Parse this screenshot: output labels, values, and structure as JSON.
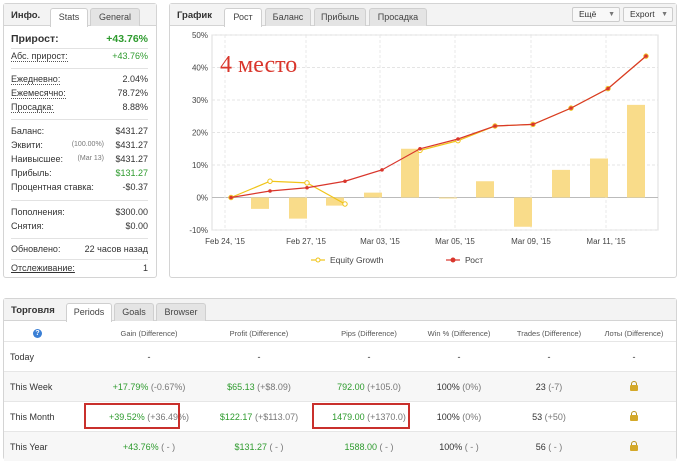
{
  "info": {
    "title": "Инфо.",
    "tabs": [
      "Stats",
      "General"
    ],
    "rows": [
      {
        "label": "Прирост:",
        "value": "+43.76%"
      },
      {
        "label": "Абс. прирост:",
        "value": "+43.76%"
      },
      {
        "label": "Ежедневно:",
        "value": "2.04%"
      },
      {
        "label": "Ежемесячно:",
        "value": "78.72%"
      },
      {
        "label": "Просадка:",
        "value": "8.88%"
      },
      {
        "label": "Баланс:",
        "value": "$431.27"
      },
      {
        "label": "Эквити:",
        "sub": "(100.00%)",
        "value": "$431.27"
      },
      {
        "label": "Наивысшее:",
        "sub": "(Mar 13)",
        "value": "$431.27"
      },
      {
        "label": "Прибыль:",
        "value": "$131.27"
      },
      {
        "label": "Процентная ставка:",
        "value": "-$0.37"
      },
      {
        "label": "Пополнения:",
        "value": "$300.00"
      },
      {
        "label": "Снятия:",
        "value": "$0.00"
      },
      {
        "label": "Обновлено:",
        "value": "22 часов назад"
      },
      {
        "label": "Отслеживание:",
        "value": "1"
      }
    ]
  },
  "chart_panel": {
    "title": "График",
    "tabs": [
      "Рост",
      "Баланс",
      "Прибыль",
      "Просадка"
    ],
    "more_button": "Ещё",
    "export_button": "Export",
    "annotation": "4 место"
  },
  "chart_data": {
    "type": "bar+line",
    "x_ticks": [
      "Feb 24, '15",
      "Feb 27, '15",
      "Mar 03, '15",
      "Mar 05, '15",
      "Mar 09, '15",
      "Mar 11, '15"
    ],
    "y_ticks": [
      "50%",
      "40%",
      "30%",
      "20%",
      "10%",
      "0%",
      "-10%"
    ],
    "ylim": [
      -10,
      50
    ],
    "bars": [
      -3.5,
      -6.5,
      -2.5,
      1.5,
      15,
      0,
      5,
      -9,
      8.5,
      12,
      28.5
    ],
    "series": [
      {
        "name": "Equity Growth",
        "color": "#f0c419",
        "values": [
          0,
          5,
          4.5,
          -2,
          null,
          14.5,
          17.5,
          22,
          22.5,
          27.5,
          33.5,
          43.5
        ]
      },
      {
        "name": "Рост",
        "color": "#d9362c",
        "values": [
          0,
          2,
          3,
          5,
          8.5,
          15,
          18,
          22,
          22.5,
          27.5,
          33.5,
          43.5
        ]
      }
    ],
    "grid": true,
    "legend": "bottom"
  },
  "trade": {
    "title": "Торговля",
    "tabs": [
      "Periods",
      "Goals",
      "Browser"
    ],
    "help_icon": "?",
    "headers": [
      "Gain (Difference)",
      "Profit (Difference)",
      "Pips (Difference)",
      "Win % (Difference)",
      "Trades (Difference)",
      "Лоты (Difference)"
    ],
    "rows": [
      {
        "name": "Today",
        "gain": "-",
        "gain_diff": "",
        "profit": "-",
        "profit_diff": "",
        "pips": "-",
        "pips_diff": "",
        "win": "-",
        "win_diff": "",
        "trades": "-",
        "trades_diff": "",
        "lots": "-"
      },
      {
        "name": "This Week",
        "gain": "+17.79%",
        "gain_diff": "(-0.67%)",
        "profit": "$65.13",
        "profit_diff": "(+$8.09)",
        "pips": "792.00",
        "pips_diff": "(+105.0)",
        "win": "100%",
        "win_diff": "(0%)",
        "trades": "23",
        "trades_diff": "(-7)",
        "lots": "lock"
      },
      {
        "name": "This Month",
        "gain": "+39.52%",
        "gain_diff": "(+36.49%)",
        "profit": "$122.17",
        "profit_diff": "(+$113.07)",
        "pips": "1479.00",
        "pips_diff": "(+1370.0)",
        "win": "100%",
        "win_diff": "(0%)",
        "trades": "53",
        "trades_diff": "(+50)",
        "lots": "lock"
      },
      {
        "name": "This Year",
        "gain": "+43.76%",
        "gain_diff": "( - )",
        "profit": "$131.27",
        "profit_diff": "( - )",
        "pips": "1588.00",
        "pips_diff": "( - )",
        "win": "100%",
        "win_diff": "( - )",
        "trades": "56",
        "trades_diff": "( - )",
        "lots": "lock"
      }
    ]
  }
}
